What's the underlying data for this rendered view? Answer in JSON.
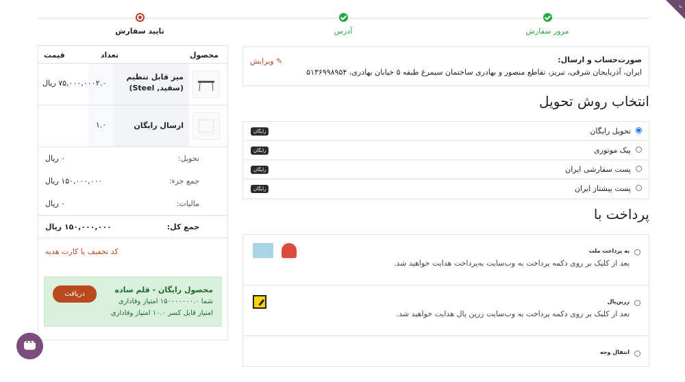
{
  "steps": [
    {
      "label": "مرور سفارش",
      "state": "done"
    },
    {
      "label": "آدرس",
      "state": "done"
    },
    {
      "label": "تایید سفارش",
      "state": "current"
    }
  ],
  "summary": {
    "headers": {
      "product": "محصول",
      "qty": "تعداد",
      "price": "قیمت"
    },
    "items": [
      {
        "name": "میز قابل تنظیم (سفید, Steel)",
        "qty": "۲.۰",
        "price": "۷۵,۰۰۰,۰۰۰ ریال"
      },
      {
        "name": "ارسال رایگان",
        "qty": "۱.۰",
        "price": ""
      }
    ],
    "delivery_label": "تحویل:",
    "delivery_value": "۰ ریال",
    "subtotal_label": "جمع جزء:",
    "subtotal_value": "۱۵۰,۰۰۰,۰۰۰ ریال",
    "tax_label": "مالیات:",
    "tax_value": "۰ ریال",
    "total_label": "جمع کل:",
    "total_value": "۱۵۰,۰۰۰,۰۰۰ ریال",
    "promo_link": "کد تخفیف یا کارت هدیه"
  },
  "loyalty": {
    "title": "محصول رایگان - قلم ساده",
    "line1": "شما ۱۵۰۰۰۰۰۰۰.۰ امتیاز وفاداری",
    "line2": "امتیاز قابل کسر ۱۰.۰ امتیاز وفاداری",
    "button": "دریافت"
  },
  "address": {
    "title": "صورت‌حساب و ارسال:",
    "text": "ایران، آذربایجان شرقی، تبریز، تقاطع منصور و بهادری ساختمان سیمرغ طبقه ۵ خیابان بهادری، ۵۱۳۶۹۹۸۹۵۴",
    "edit": "ویرایش"
  },
  "delivery": {
    "heading": "انتخاب روش تحویل",
    "options": [
      {
        "label": "تحویل رایگان",
        "badge": "رایگان",
        "selected": true
      },
      {
        "label": "پیک موتوری",
        "badge": "رایگان",
        "selected": false
      },
      {
        "label": "پست سفارشی ایران",
        "badge": "رایگان",
        "selected": false
      },
      {
        "label": "پست پیشتاز ایران",
        "badge": "رایگان",
        "selected": false
      }
    ]
  },
  "payment": {
    "heading": "پرداخت با",
    "methods": [
      {
        "label": "به پرداخت ملت",
        "desc": "بعد از کلیک بر روی دکمه پرداخت به وب‌سایت به‌پرداخت هدایت خواهید شد."
      },
      {
        "label": "زرین‌پال",
        "desc": "بعد از کلیک بر روی دکمه پرداخت به وب‌سایت زرین پال هدایت خواهید شد."
      },
      {
        "label": "انتقال وجه",
        "desc": ""
      }
    ]
  },
  "colors": {
    "accent": "#b84a1e",
    "done": "#28a745",
    "loyalty_bg": "#d9f0dc",
    "chat": "#7a4d7d"
  }
}
